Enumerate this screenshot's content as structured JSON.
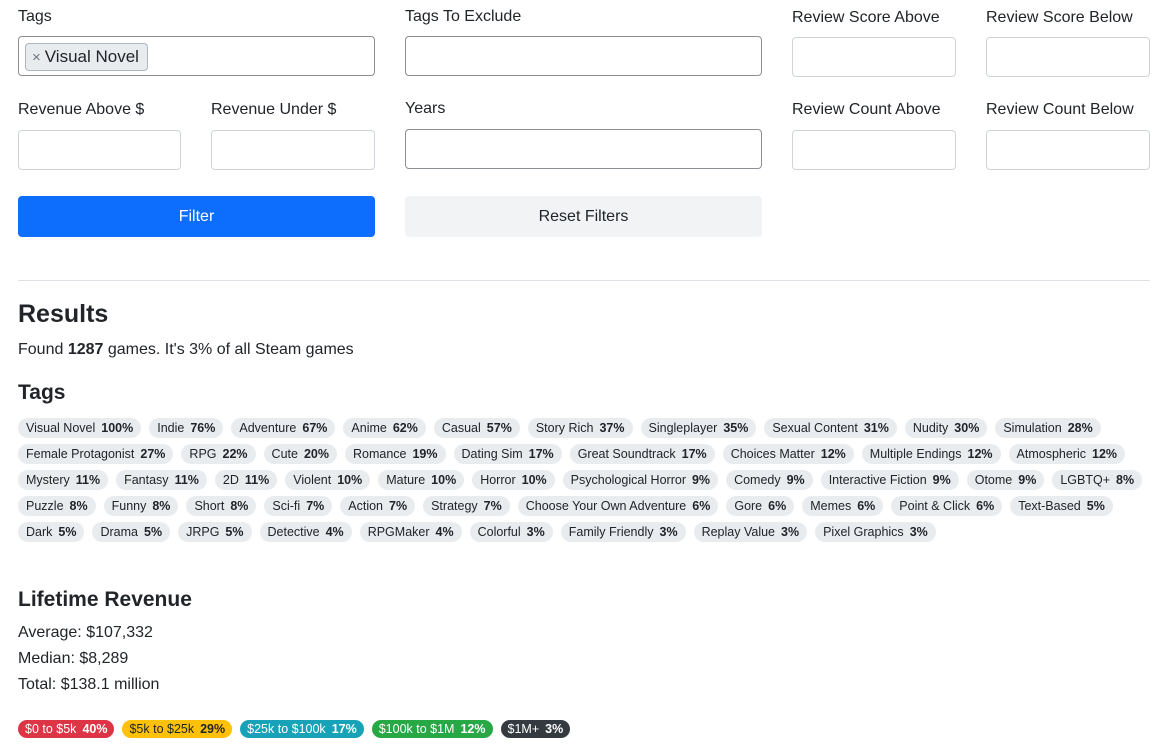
{
  "filters": {
    "tags": {
      "label": "Tags",
      "selected": [
        "Visual Novel"
      ],
      "remove_glyph": "×"
    },
    "tags_exclude": {
      "label": "Tags To Exclude",
      "value": ""
    },
    "review_score_above": {
      "label": "Review Score Above",
      "value": ""
    },
    "review_score_below": {
      "label": "Review Score Below",
      "value": ""
    },
    "revenue_above": {
      "label": "Revenue Above $",
      "value": ""
    },
    "revenue_under": {
      "label": "Revenue Under $",
      "value": ""
    },
    "years": {
      "label": "Years",
      "value": ""
    },
    "review_count_above": {
      "label": "Review Count Above",
      "value": ""
    },
    "review_count_below": {
      "label": "Review Count Below",
      "value": ""
    },
    "filter_button": "Filter",
    "reset_button": "Reset Filters"
  },
  "results": {
    "title": "Results",
    "found_prefix": "Found ",
    "found_count": "1287",
    "found_suffix": " games. It's 3% of all Steam games"
  },
  "tags_section": {
    "title": "Tags",
    "items": [
      {
        "name": "Visual Novel",
        "pct": "100%"
      },
      {
        "name": "Indie",
        "pct": "76%"
      },
      {
        "name": "Adventure",
        "pct": "67%"
      },
      {
        "name": "Anime",
        "pct": "62%"
      },
      {
        "name": "Casual",
        "pct": "57%"
      },
      {
        "name": "Story Rich",
        "pct": "37%"
      },
      {
        "name": "Singleplayer",
        "pct": "35%"
      },
      {
        "name": "Sexual Content",
        "pct": "31%"
      },
      {
        "name": "Nudity",
        "pct": "30%"
      },
      {
        "name": "Simulation",
        "pct": "28%"
      },
      {
        "name": "Female Protagonist",
        "pct": "27%"
      },
      {
        "name": "RPG",
        "pct": "22%"
      },
      {
        "name": "Cute",
        "pct": "20%"
      },
      {
        "name": "Romance",
        "pct": "19%"
      },
      {
        "name": "Dating Sim",
        "pct": "17%"
      },
      {
        "name": "Great Soundtrack",
        "pct": "17%"
      },
      {
        "name": "Choices Matter",
        "pct": "12%"
      },
      {
        "name": "Multiple Endings",
        "pct": "12%"
      },
      {
        "name": "Atmospheric",
        "pct": "12%"
      },
      {
        "name": "Mystery",
        "pct": "11%"
      },
      {
        "name": "Fantasy",
        "pct": "11%"
      },
      {
        "name": "2D",
        "pct": "11%"
      },
      {
        "name": "Violent",
        "pct": "10%"
      },
      {
        "name": "Mature",
        "pct": "10%"
      },
      {
        "name": "Horror",
        "pct": "10%"
      },
      {
        "name": "Psychological Horror",
        "pct": "9%"
      },
      {
        "name": "Comedy",
        "pct": "9%"
      },
      {
        "name": "Interactive Fiction",
        "pct": "9%"
      },
      {
        "name": "Otome",
        "pct": "9%"
      },
      {
        "name": "LGBTQ+",
        "pct": "8%"
      },
      {
        "name": "Puzzle",
        "pct": "8%"
      },
      {
        "name": "Funny",
        "pct": "8%"
      },
      {
        "name": "Short",
        "pct": "8%"
      },
      {
        "name": "Sci-fi",
        "pct": "7%"
      },
      {
        "name": "Action",
        "pct": "7%"
      },
      {
        "name": "Strategy",
        "pct": "7%"
      },
      {
        "name": "Choose Your Own Adventure",
        "pct": "6%"
      },
      {
        "name": "Gore",
        "pct": "6%"
      },
      {
        "name": "Memes",
        "pct": "6%"
      },
      {
        "name": "Point & Click",
        "pct": "6%"
      },
      {
        "name": "Text-Based",
        "pct": "5%"
      },
      {
        "name": "Dark",
        "pct": "5%"
      },
      {
        "name": "Drama",
        "pct": "5%"
      },
      {
        "name": "JRPG",
        "pct": "5%"
      },
      {
        "name": "Detective",
        "pct": "4%"
      },
      {
        "name": "RPGMaker",
        "pct": "4%"
      },
      {
        "name": "Colorful",
        "pct": "3%"
      },
      {
        "name": "Family Friendly",
        "pct": "3%"
      },
      {
        "name": "Replay Value",
        "pct": "3%"
      },
      {
        "name": "Pixel Graphics",
        "pct": "3%"
      }
    ]
  },
  "revenue": {
    "title": "Lifetime Revenue",
    "average": "Average: $107,332",
    "median": "Median: $8,289",
    "total": "Total: $138.1 million",
    "buckets": [
      {
        "label": "$0 to $5k",
        "pct": "40%",
        "bg": "#dc3545",
        "fg": "#ffffff"
      },
      {
        "label": "$5k to $25k",
        "pct": "29%",
        "bg": "#ffc107",
        "fg": "#212529"
      },
      {
        "label": "$25k to $100k",
        "pct": "17%",
        "bg": "#17a2b8",
        "fg": "#ffffff"
      },
      {
        "label": "$100k to $1M",
        "pct": "12%",
        "bg": "#28a745",
        "fg": "#ffffff"
      },
      {
        "label": "$1M+",
        "pct": "3%",
        "bg": "#343a40",
        "fg": "#ffffff"
      }
    ]
  }
}
